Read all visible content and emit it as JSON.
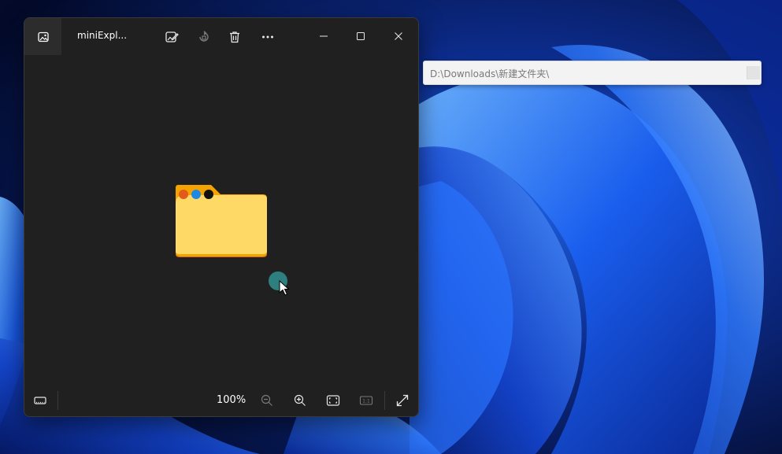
{
  "window": {
    "title": "miniExpl...",
    "zoom_label": "100%",
    "icons": {
      "app": "photos-app-icon",
      "edit": "edit-image-icon",
      "rotate": "rotate-icon",
      "delete": "delete-icon",
      "more": "more-icon",
      "minimize": "minimize-icon",
      "maximize": "maximize-icon",
      "close": "close-icon",
      "filmstrip": "filmstrip-icon",
      "zoom_out": "zoom-out-icon",
      "zoom_in": "zoom-in-icon",
      "fit": "fit-to-window-icon",
      "actual_size": "actual-size-icon",
      "fullscreen": "fullscreen-icon"
    }
  },
  "image": {
    "subject": "folder-icon",
    "dot_colors": [
      "#e25a1c",
      "#1e88e5",
      "#111111"
    ],
    "folder_tab_color": "#f4a300",
    "folder_body_color": "#ffd966"
  },
  "address_bar": {
    "path": "D:\\Downloads\\新建文件夹\\"
  },
  "colors": {
    "window_bg": "#202020",
    "cursor_highlight": "#2d7f80"
  }
}
